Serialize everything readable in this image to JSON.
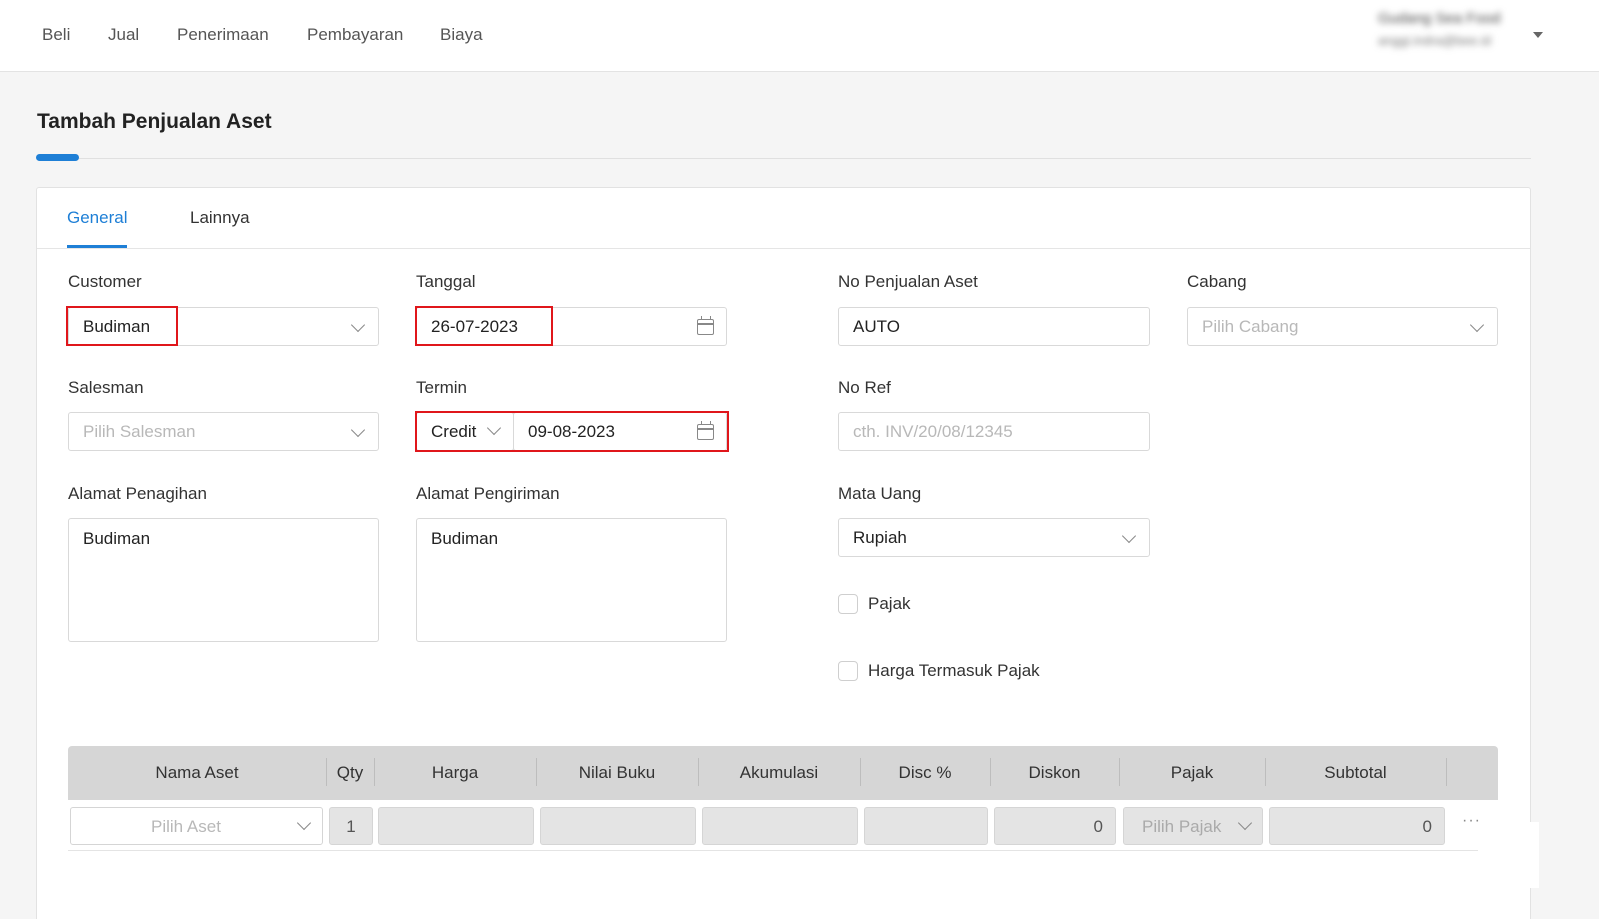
{
  "nav": {
    "items": [
      "Beli",
      "Jual",
      "Penerimaan",
      "Pembayaran",
      "Biaya"
    ],
    "user_name": "Gudang Sea Food",
    "user_email": "anggi.indra@bee.id"
  },
  "page": {
    "title": "Tambah Penjualan Aset"
  },
  "tabs": {
    "general": "General",
    "lainnya": "Lainnya"
  },
  "form": {
    "customer_label": "Customer",
    "customer_value": "Budiman",
    "tanggal_label": "Tanggal",
    "tanggal_value": "26-07-2023",
    "no_penjualan_label": "No Penjualan Aset",
    "no_penjualan_value": "AUTO",
    "cabang_label": "Cabang",
    "cabang_placeholder": "Pilih Cabang",
    "salesman_label": "Salesman",
    "salesman_placeholder": "Pilih Salesman",
    "termin_label": "Termin",
    "termin_type": "Credit",
    "termin_date": "09-08-2023",
    "no_ref_label": "No Ref",
    "no_ref_placeholder": "cth. INV/20/08/12345",
    "alamat_penagihan_label": "Alamat Penagihan",
    "alamat_penagihan_value": "Budiman",
    "alamat_pengiriman_label": "Alamat Pengiriman",
    "alamat_pengiriman_value": "Budiman",
    "mata_uang_label": "Mata Uang",
    "mata_uang_value": "Rupiah",
    "pajak_label": "Pajak",
    "harga_termasuk_pajak_label": "Harga Termasuk Pajak"
  },
  "table": {
    "headers": [
      "Nama Aset",
      "Qty",
      "Harga",
      "Nilai Buku",
      "Akumulasi",
      "Disc %",
      "Diskon",
      "Pajak",
      "Subtotal"
    ],
    "row": {
      "aset_placeholder": "Pilih Aset",
      "qty": "1",
      "diskon": "0",
      "pajak_placeholder": "Pilih Pajak",
      "subtotal": "0",
      "more": "···"
    }
  },
  "colors": {
    "accent": "#1e7fd6",
    "highlight": "#e0161b"
  },
  "icons": [
    "chevron-down-icon",
    "calendar-icon",
    "more-icon"
  ]
}
